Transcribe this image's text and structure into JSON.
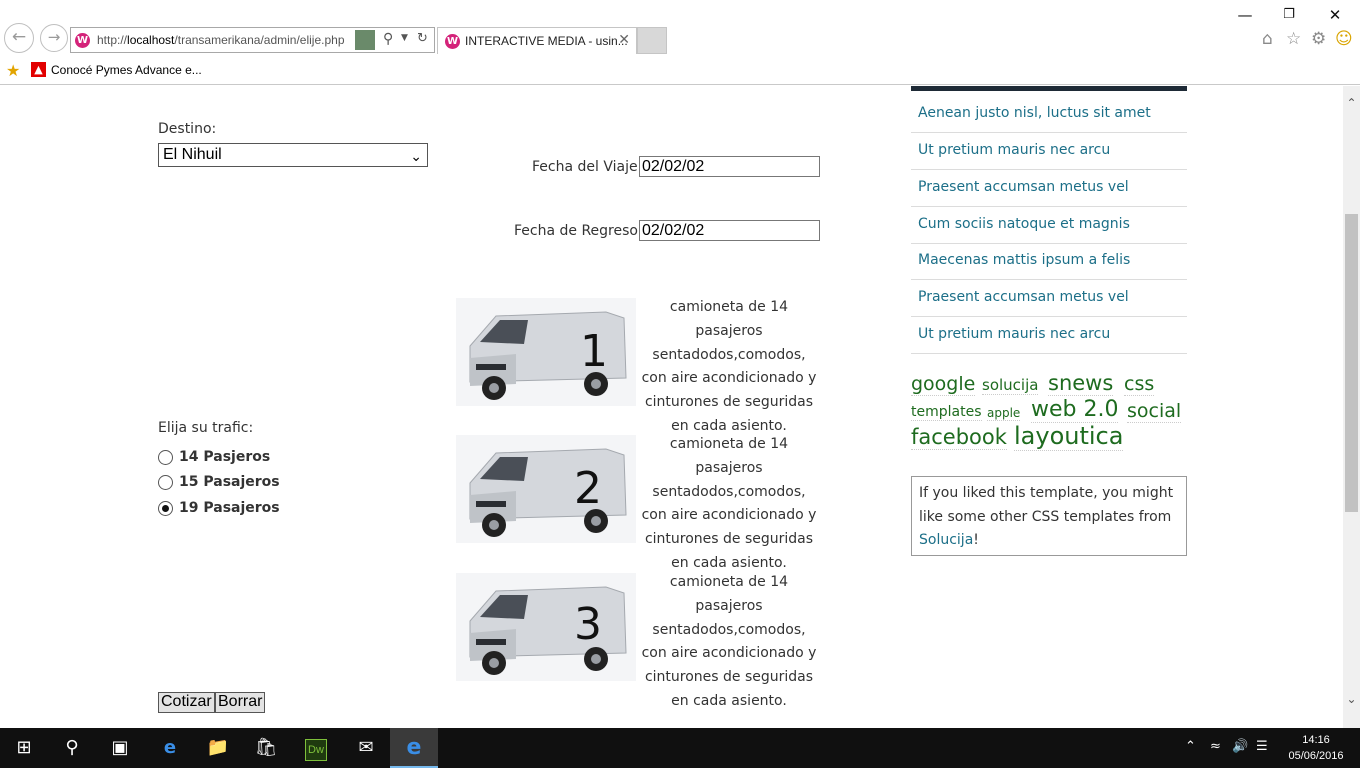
{
  "browser": {
    "url_prefix": "http://",
    "url_host": "localhost",
    "url_path": "/transamerikana/admin/elije.php",
    "tab_title": "INTERACTIVE MEDIA - usin...",
    "favorite_label": "Conocé Pymes Advance e..."
  },
  "form": {
    "destino_label": "Destino:",
    "destino_value": "El Nihuil",
    "fecha_viaje_label": "Fecha del Viaje:",
    "fecha_viaje_value": "02/02/02",
    "fecha_regreso_label": "Fecha de Regreso:",
    "fecha_regreso_value": "02/02/02",
    "trafic_label": "Elija su trafic:",
    "options": [
      {
        "label": "14 Pasjeros",
        "checked": false
      },
      {
        "label": "15 Pasajeros",
        "checked": false
      },
      {
        "label": "19 Pasajeros",
        "checked": true
      }
    ],
    "submit_label": "Cotizar",
    "reset_label": "Borrar"
  },
  "vans": [
    {
      "number": "1",
      "description": "camioneta de 14 pasajeros sentadodos,comodos, con aire acondicionado y cinturones de seguridas en cada asiento."
    },
    {
      "number": "2",
      "description": "camioneta de 14 pasajeros sentadodos,comodos, con aire acondicionado y cinturones de seguridas en cada asiento."
    },
    {
      "number": "3",
      "description": "camioneta de 14 pasajeros sentadodos,comodos, con aire acondicionado y cinturones de seguridas en cada asiento."
    }
  ],
  "sidebar": {
    "links": [
      "Aenean justo nisl, luctus sit amet",
      "Ut pretium mauris nec arcu",
      "Praesent accumsan metus vel",
      "Cum sociis natoque et magnis",
      "Maecenas mattis ipsum a felis",
      "Praesent accumsan metus vel",
      "Ut pretium mauris nec arcu"
    ],
    "tags": [
      "google",
      "solucija",
      "snews",
      "css",
      "templates",
      "apple",
      "web 2.0",
      "social",
      "facebook",
      "layoutica"
    ],
    "promo_text": "If you liked this template, you might like some other CSS templates from ",
    "promo_link": "Solucija",
    "promo_end": "!"
  },
  "taskbar": {
    "time": "14:16",
    "date": "05/06/2016",
    "apps": [
      "windows-start",
      "search",
      "task-view",
      "edge",
      "file-explorer",
      "store",
      "dreamweaver",
      "mail",
      "internet-explorer"
    ]
  },
  "colors": {
    "link": "#1c6f88",
    "tag": "#1e6b1f",
    "sidebar_bar": "#1e2a36",
    "taskbar": "#101010"
  }
}
